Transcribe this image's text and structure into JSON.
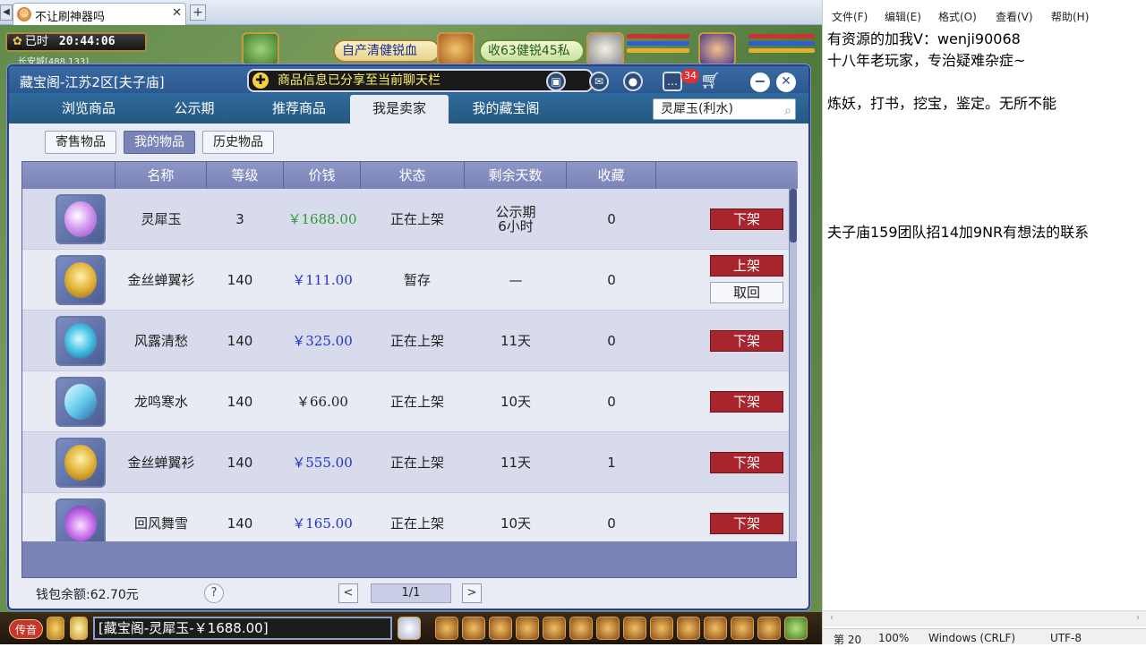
{
  "browser": {
    "tab_title": "不让刷神器吗",
    "new_tab": "+",
    "close": "✕"
  },
  "hud": {
    "time_label": "已时",
    "time": "20:44:06",
    "location": "长安城[488,133]",
    "banner1": "自产清健锐血",
    "banner2": "收63健锐45私"
  },
  "window": {
    "title": "藏宝阁-江苏2区[夫子庙]",
    "share_note": "商品信息已分享至当前聊天栏",
    "badge_count": "34",
    "main_tabs": [
      {
        "label": "浏览商品"
      },
      {
        "label": "公示期"
      },
      {
        "label": "推荐商品"
      },
      {
        "label": "我是卖家"
      },
      {
        "label": "我的藏宝阁"
      }
    ],
    "active_tab": 3,
    "search_value": "灵犀玉(利水)",
    "sub_tabs": [
      {
        "label": "寄售物品"
      },
      {
        "label": "我的物品"
      },
      {
        "label": "历史物品"
      }
    ],
    "active_sub_tab": 1
  },
  "table": {
    "headers": [
      "名称",
      "等级",
      "价钱",
      "状态",
      "剩余天数",
      "收藏"
    ],
    "rows": [
      {
        "icon": "pearl-icon",
        "name": "灵犀玉",
        "level": "3",
        "price": "￥1688.00",
        "price_color": "#2e9a38",
        "status": "正在上架",
        "days_line1": "公示期",
        "days_line2": "6小时",
        "fav": "0",
        "buttons": [
          {
            "label": "下架",
            "style": "red"
          }
        ]
      },
      {
        "icon": "robe-icon",
        "name": "金丝蝉翼衫",
        "level": "140",
        "price": "￥111.00",
        "price_color": "#2233cc",
        "status": "暂存",
        "days_line1": "—",
        "days_line2": "",
        "fav": "0",
        "buttons": [
          {
            "label": "上架",
            "style": "red"
          },
          {
            "label": "取回",
            "style": "white"
          }
        ]
      },
      {
        "icon": "orb-icon",
        "name": "风露清愁",
        "level": "140",
        "price": "￥325.00",
        "price_color": "#2233cc",
        "status": "正在上架",
        "days_line1": "11天",
        "days_line2": "",
        "fav": "0",
        "buttons": [
          {
            "label": "下架",
            "style": "red"
          }
        ]
      },
      {
        "icon": "blade-icon",
        "name": "龙鸣寒水",
        "level": "140",
        "price": "￥66.00",
        "price_color": "#222222",
        "status": "正在上架",
        "days_line1": "10天",
        "days_line2": "",
        "fav": "0",
        "buttons": [
          {
            "label": "下架",
            "style": "red"
          }
        ]
      },
      {
        "icon": "robe-icon",
        "name": "金丝蝉翼衫",
        "level": "140",
        "price": "￥555.00",
        "price_color": "#2233cc",
        "status": "正在上架",
        "days_line1": "11天",
        "days_line2": "",
        "fav": "1",
        "buttons": [
          {
            "label": "下架",
            "style": "red"
          }
        ]
      },
      {
        "icon": "flame-icon",
        "name": "回风舞雪",
        "level": "140",
        "price": "￥165.00",
        "price_color": "#2233cc",
        "status": "正在上架",
        "days_line1": "10天",
        "days_line2": "",
        "fav": "0",
        "buttons": [
          {
            "label": "下架",
            "style": "red"
          }
        ]
      }
    ]
  },
  "footer": {
    "wallet": "钱包余额:62.70元",
    "help": "?",
    "page": "1/1",
    "prev": "<",
    "next": ">"
  },
  "chat": {
    "channel": "传音",
    "message": "[藏宝阁-灵犀玉-￥1688.00]"
  },
  "notepad": {
    "menus": [
      "文件(F)",
      "编辑(E)",
      "格式(O)",
      "查看(V)",
      "帮助(H)"
    ],
    "lines": [
      "有资源的加我V：wenji90068",
      "十八年老玩家，专治疑难杂症~",
      "",
      "炼妖，打书，挖宝，鉴定。无所不能",
      "",
      "",
      "",
      "",
      "",
      "夫子庙159团队招14加9NR有想法的联系"
    ],
    "status": {
      "pos": "第 20",
      "zoom": "100%",
      "eol": "Windows (CRLF)",
      "enc": "UTF-8"
    }
  }
}
